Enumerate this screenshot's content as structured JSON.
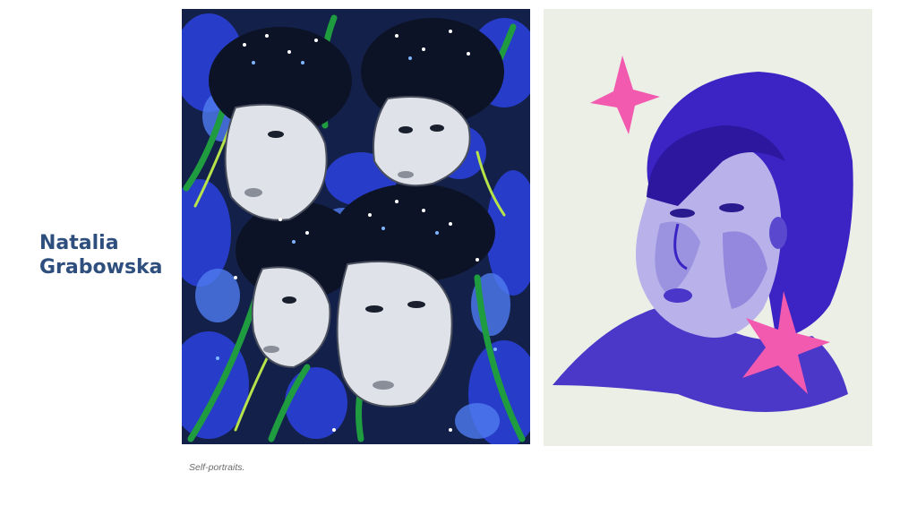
{
  "artist": {
    "first_name": "Natalia",
    "last_name": "Grabowska"
  },
  "caption": "Self-portraits.",
  "artworks": [
    {
      "icon": "painting-four-faces-irises"
    },
    {
      "icon": "drawing-blue-portrait-pink-stars"
    }
  ],
  "colors": {
    "title": "#2e4f7e",
    "caption": "#6b6b6b",
    "ink_blue": "#3b23c4",
    "star_pink": "#f25ab0",
    "leaf_green": "#1f9c3f"
  }
}
